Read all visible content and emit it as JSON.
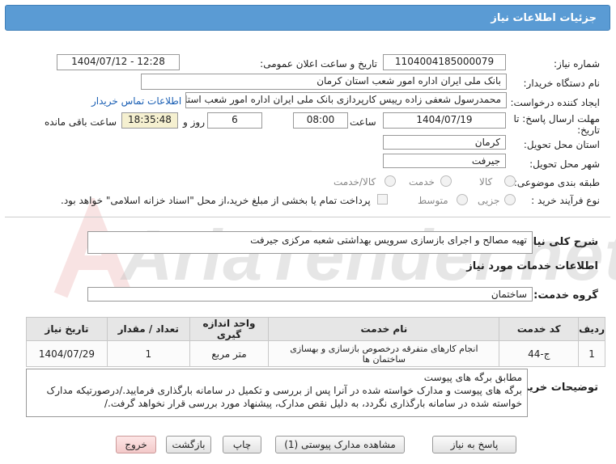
{
  "header": {
    "title": "جزئیات اطلاعات نیاز"
  },
  "fields": {
    "need_number_label": "شماره نیاز:",
    "need_number": "1104004185000079",
    "announce_label": "تاریخ و ساعت اعلان عمومی:",
    "announce_value": "1404/07/12 - 12:28",
    "buyer_label": "نام دستگاه خریدار:",
    "buyer_value": "بانک ملی ایران اداره امور شعب استان کرمان",
    "creator_label": "ایجاد کننده درخواست:",
    "creator_value": "محمدرسول شعفی زاده رییس کارپردازی بانک ملی ایران اداره امور شعب استان",
    "contact_link": "اطلاعات تماس خریدار",
    "deadline_label": "مهلت ارسال پاسخ: تا",
    "deadline_label2": "تاریخ:",
    "deadline_date": "1404/07/19",
    "time_label": "ساعت",
    "deadline_time": "08:00",
    "days_value": "6",
    "days_label": "روز و",
    "remaining_time": "18:35:48",
    "remaining_label": "ساعت باقی مانده",
    "province_label": "استان محل تحویل:",
    "province_value": "کرمان",
    "city_label": "شهر محل تحویل:",
    "city_value": "جیرفت",
    "category_label": "طبقه بندی موضوعی:",
    "category_options": [
      "کالا",
      "خدمت",
      "کالا/خدمت"
    ],
    "process_label": "نوع فرآیند خرید :",
    "process_options": [
      "جزیی",
      "متوسط"
    ],
    "payment_note": "پرداخت تمام یا بخشی از مبلغ خرید،از محل \"اسناد خزانه اسلامی\" خواهد بود."
  },
  "description": {
    "label": "شرح کلی نیاز:",
    "value": "تهیه مصالح و اجرای بازسازی سرویس بهداشتی شعبه مرکزی جیرفت"
  },
  "services": {
    "section_label": "اطلاعات خدمات مورد نیاز",
    "group_label": "گروه خدمت:",
    "group_value": "ساختمان",
    "columns": [
      "ردیف",
      "کد خدمت",
      "نام خدمت",
      "واحد اندازه گیری",
      "تعداد / مقدار",
      "تاریخ نیاز"
    ],
    "rows": [
      [
        "1",
        "ج-44",
        "انجام کارهای متفرقه درخصوص بازسازی و بهسازی ساختمان ها",
        "متر مربع",
        "1",
        "1404/07/29"
      ]
    ]
  },
  "buyer_notes": {
    "label": "توضیحات خریدار:",
    "line1": "مطابق برگه های پیوست",
    "line2": "برگه های پیوست و مدارک خواسته شده در آنرا پس از بررسی و تکمیل در سامانه بارگذاری فرمایید./درصورتیکه مدارک",
    "line3": "خواسته شده در سامانه بارگذاری نگردد، به دلیل نقص مدارک، پیشنهاد مورد بررسی قرار نخواهد گرفت./"
  },
  "buttons": {
    "reply": "پاسخ به نیاز",
    "attachments": "مشاهده مدارک پیوستی (1)",
    "print": "چاپ",
    "back": "بازگشت",
    "exit": "خروج"
  },
  "watermark": {
    "text": "AriaTender.net"
  },
  "colors": {
    "header": "#5a9bd4",
    "link": "#1a5fb4",
    "remaining_bg": "#f5f0d0"
  }
}
